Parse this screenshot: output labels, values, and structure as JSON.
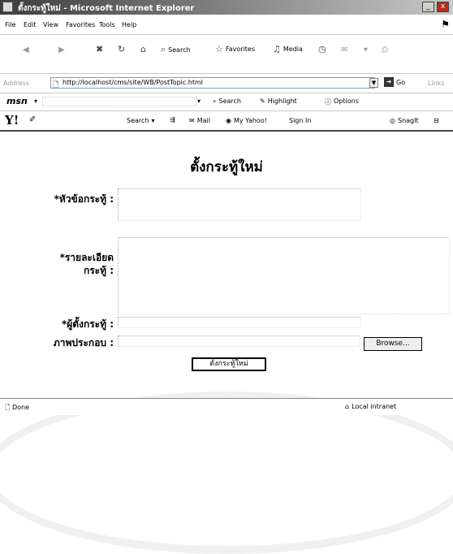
{
  "window": {
    "title": "ตั้งกระทู้ใหม่ - Microsoft Internet Explorer",
    "minimize": "_",
    "close": "x"
  },
  "menubar": [
    "File",
    "Edit",
    "View",
    "Favorites",
    "Tools",
    "Help"
  ],
  "toolbar": {
    "search": "Search",
    "favorites": "Favorites",
    "media": "Media"
  },
  "address_bar": {
    "label": "Address",
    "url": "http://localhost/cms/site/WB/PostTopic.html",
    "go": "Go",
    "links": "Links"
  },
  "msn_bar": {
    "logo": "msn",
    "search": "Search",
    "highlight": "Highlight",
    "options": "Options"
  },
  "yahoo_bar": {
    "logo": "Y!",
    "search": "Search",
    "mail": "Mail",
    "my_yahoo": "My Yahoo!",
    "sign_in": "Sign In",
    "snagit": "SnagIt"
  },
  "form": {
    "title": "ตั้งกระทู้ใหม่",
    "topic_label": "*หัวข้อกระทู้ :",
    "topic_value": "",
    "detail_label_1": "*รายละเอียด",
    "detail_label_2": "กระทู้ :",
    "detail_value": "",
    "author_label": "*ผู้ตั้งกระทู้ :",
    "author_value": "",
    "image_label": "ภาพประกอบ :",
    "image_value": "",
    "browse_button": "Browse...",
    "submit_button": "ตั้งกระทู้ใหม่"
  },
  "status_bar": {
    "status": "Done",
    "zone": "Local intranet"
  }
}
